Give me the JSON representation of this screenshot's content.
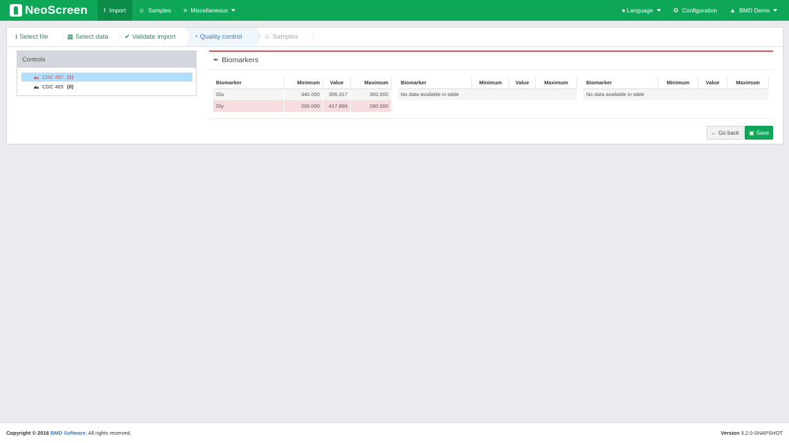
{
  "brand": {
    "name": "NeoScreen"
  },
  "nav": {
    "items": [
      {
        "label": "Import",
        "icon": "download-icon",
        "active": true
      },
      {
        "label": "Samples",
        "icon": "users-icon"
      },
      {
        "label": "Miscellaneous",
        "icon": "sliders-icon"
      }
    ],
    "right": [
      {
        "label": "Language",
        "icon": "globe-icon"
      },
      {
        "label": "Configuration",
        "icon": "gears-icon"
      },
      {
        "label": "BMD Demo",
        "icon": "user-icon"
      }
    ]
  },
  "steps": [
    {
      "label": "Select file",
      "icon": "download-icon",
      "state": "done"
    },
    {
      "label": "Select data",
      "icon": "table-icon",
      "state": "done"
    },
    {
      "label": "Validate import",
      "icon": "check-circle-icon",
      "state": "done"
    },
    {
      "label": "Quality control",
      "icon": "dashboard-icon",
      "state": "current"
    },
    {
      "label": "Samples",
      "icon": "users-icon",
      "state": "disabled"
    }
  ],
  "controls": {
    "title": "Controls",
    "items": [
      {
        "name": "CDC 467",
        "count": "(1)",
        "selected": true
      },
      {
        "name": "CDC 465",
        "count": "(0)",
        "selected": false
      }
    ]
  },
  "biomarkers": {
    "title": "Biomarkers",
    "headers": [
      "Biomarker",
      "Minimum",
      "Value",
      "Maximum"
    ],
    "tables": [
      {
        "rows": [
          {
            "biomarker": "Glu",
            "minimum": "340.000",
            "value": "356.317",
            "maximum": "360.000",
            "out_of_range": false
          },
          {
            "biomarker": "Gly",
            "minimum": "200.000",
            "value": "417.869",
            "maximum": "290.000",
            "out_of_range": true
          }
        ]
      },
      {
        "empty_text": "No data available in table"
      },
      {
        "empty_text": "No data available in table"
      }
    ]
  },
  "buttons": {
    "back": "Go back",
    "save": "Save"
  },
  "footer": {
    "copyright_prefix": "Copyright © 2016",
    "company": "BMD Software",
    "rights": ". All rights reserved.",
    "version_label": "Version",
    "version_value": "3.2.0-SNAPSHOT"
  },
  "colors": {
    "primary": "#0ea758",
    "danger": "#d9534f",
    "link": "#3a7bbf",
    "selected_row": "#b3defa"
  }
}
